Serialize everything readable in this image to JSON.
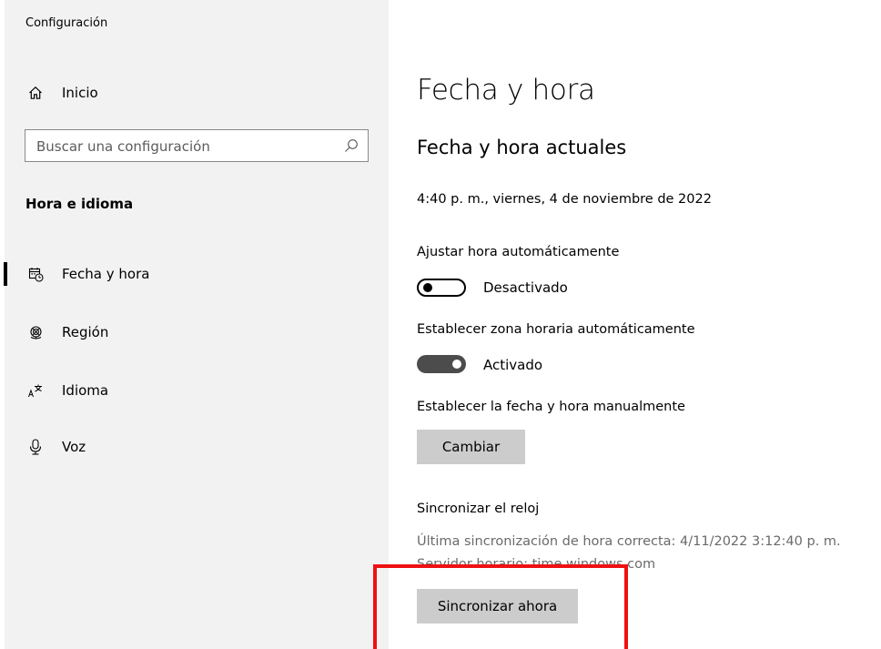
{
  "app": {
    "title": "Configuración"
  },
  "sidebar": {
    "home_label": "Inicio",
    "search_placeholder": "Buscar una configuración",
    "section_title": "Hora e idioma",
    "items": [
      {
        "label": "Fecha y hora",
        "icon": "calendar-clock-icon",
        "selected": true
      },
      {
        "label": "Región",
        "icon": "globe-icon",
        "selected": false
      },
      {
        "label": "Idioma",
        "icon": "language-icon",
        "selected": false
      },
      {
        "label": "Voz",
        "icon": "microphone-icon",
        "selected": false
      }
    ]
  },
  "main": {
    "title": "Fecha y hora",
    "subtitle": "Fecha y hora actuales",
    "current_datetime": "4:40 p. m., viernes, 4 de noviembre de 2022",
    "auto_time": {
      "label": "Ajustar hora automáticamente",
      "state": "Desactivado",
      "on": false
    },
    "auto_timezone": {
      "label": "Establecer zona horaria automáticamente",
      "state": "Activado",
      "on": true
    },
    "manual": {
      "label": "Establecer la fecha y hora manualmente",
      "button": "Cambiar"
    },
    "sync": {
      "title": "Sincronizar el reloj",
      "last_sync": "Última sincronización de hora correcta: 4/11/2022 3:12:40 p. m.",
      "server": "Servidor horario: time.windows.com",
      "button": "Sincronizar ahora"
    }
  },
  "annotation": {
    "color": "#ee1111"
  }
}
